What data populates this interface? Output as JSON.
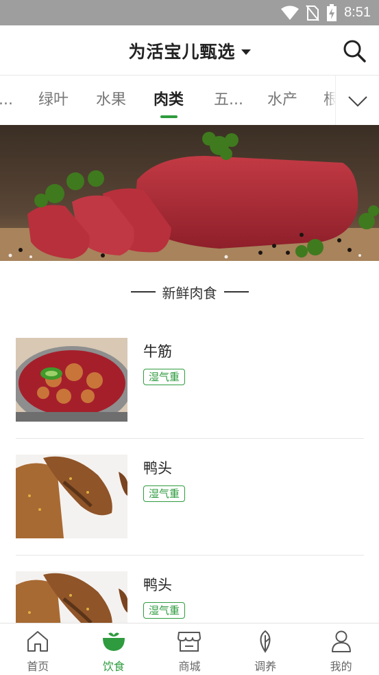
{
  "status_bar": {
    "time": "8:51",
    "icons": [
      "wifi-icon",
      "no-sim-icon",
      "battery-charging-icon"
    ]
  },
  "header": {
    "title": "为活宝儿甄选",
    "search_icon": "search-icon"
  },
  "tabs": {
    "items": [
      {
        "label": "...",
        "active": false
      },
      {
        "label": "绿叶",
        "active": false
      },
      {
        "label": "水果",
        "active": false
      },
      {
        "label": "肉类",
        "active": true
      },
      {
        "label": "五...",
        "active": false
      },
      {
        "label": "水产",
        "active": false
      },
      {
        "label": "根",
        "active": false
      }
    ],
    "expand_icon": "chevron-down-icon"
  },
  "section": {
    "title": "新鲜肉食"
  },
  "items": [
    {
      "name": "牛筋",
      "tag": "湿气重"
    },
    {
      "name": "鸭头",
      "tag": "湿气重"
    },
    {
      "name": "鸭头",
      "tag": "湿气重"
    }
  ],
  "bottom_nav": [
    {
      "label": "首页",
      "icon": "home-icon",
      "active": false
    },
    {
      "label": "饮食",
      "icon": "bowl-icon",
      "active": true
    },
    {
      "label": "商城",
      "icon": "store-icon",
      "active": false
    },
    {
      "label": "调养",
      "icon": "leaf-icon",
      "active": false
    },
    {
      "label": "我的",
      "icon": "person-icon",
      "active": false
    }
  ],
  "colors": {
    "accent": "#2e9b3e",
    "status_bar": "#9e9e9e"
  }
}
